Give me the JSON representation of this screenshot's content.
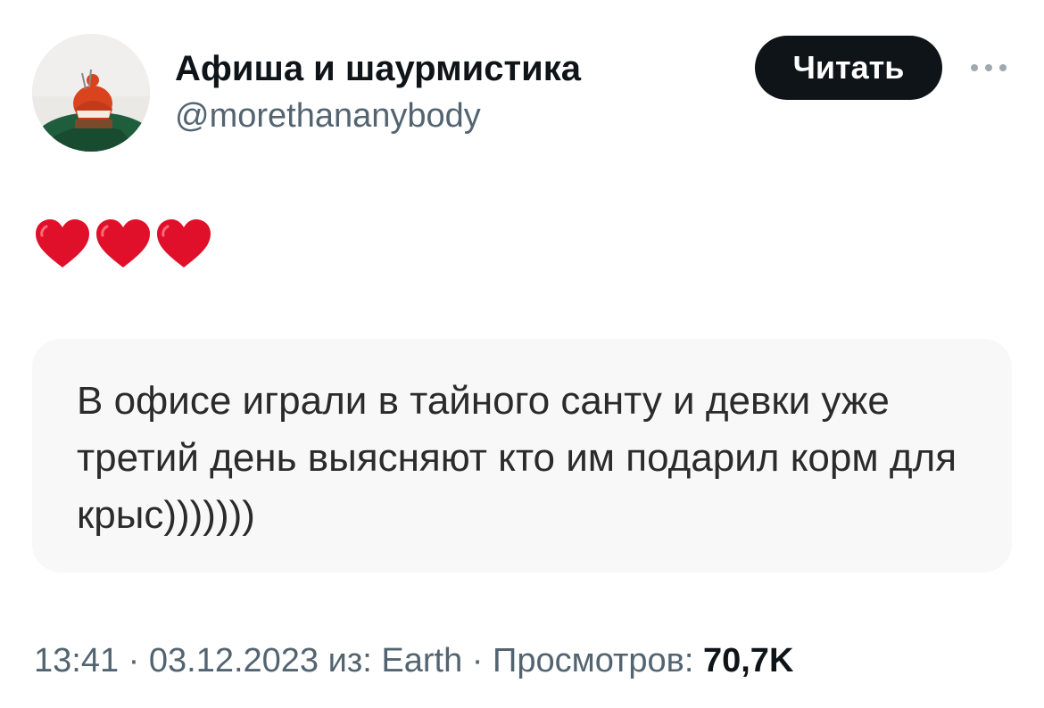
{
  "author": {
    "display_name": "Афиша и шаурмистика",
    "handle": "@morethananybody",
    "avatar_icon": "profile-photo-avatar"
  },
  "follow_button": {
    "label": "Читать",
    "bg_color": "#0f1419",
    "text_color": "#ffffff"
  },
  "more_button": {
    "icon": "ellipsis-icon"
  },
  "tweet": {
    "emoji_icons": [
      "red-heart-icon",
      "red-heart-icon",
      "red-heart-icon"
    ],
    "quoted_text": "В офисе играли в тайного санту и девки уже третий день выясняют кто им подарил корм для крыс)))))))"
  },
  "meta": {
    "time": "13:41",
    "separator": " · ",
    "date": "03.12.2023",
    "source": "из: Earth",
    "views_label": "Просмотров:",
    "views_count": "70,7K"
  },
  "colors": {
    "heart": "#e0102a",
    "secondary_text": "#536471",
    "primary_text": "#0f1419",
    "card_bg": "#f8f8f8"
  }
}
